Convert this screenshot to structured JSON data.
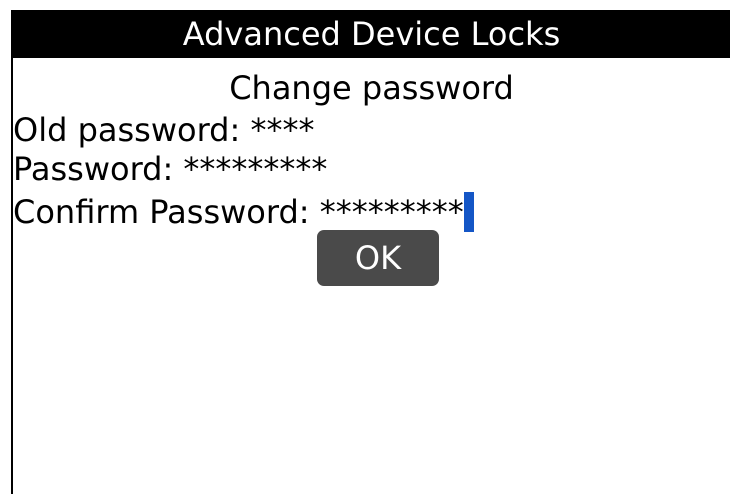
{
  "window": {
    "title": "Advanced Device Locks"
  },
  "dialog": {
    "heading": "Change password",
    "fields": {
      "old_password": {
        "label": "Old password: ",
        "value": "****"
      },
      "password": {
        "label": "Password: ",
        "value": "*********"
      },
      "confirm_password": {
        "label": "Confirm Password: ",
        "value": "*********"
      }
    },
    "ok_label": "OK"
  },
  "colors": {
    "titlebar_bg": "#000000",
    "titlebar_text": "#ffffff",
    "cursor": "#1456c6",
    "button_bg": "#4a4a4a",
    "button_text": "#ffffff"
  }
}
